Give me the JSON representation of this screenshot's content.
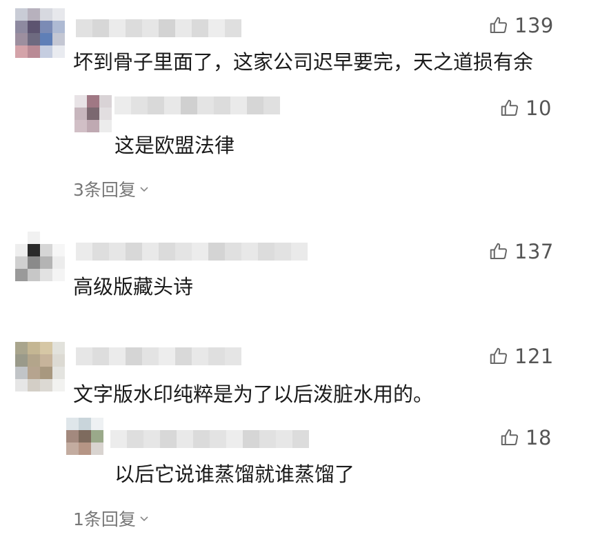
{
  "comments": [
    {
      "likes": "139",
      "text": "坏到骨子里面了，这家公司迟早要完，天之道损有余",
      "replies": [
        {
          "likes": "10",
          "text": "这是欧盟法律"
        }
      ],
      "more_replies": "3条回复"
    },
    {
      "likes": "137",
      "text": "高级版藏头诗",
      "replies": []
    },
    {
      "likes": "121",
      "text": "文字版水印纯粹是为了以后泼脏水用的。",
      "replies": [
        {
          "likes": "18",
          "text": "以后它说谁蒸馏就谁蒸馏了"
        }
      ],
      "more_replies": "1条回复"
    }
  ],
  "icons": {
    "like": "thumbs-up-icon",
    "expand": "chevron-down-icon"
  },
  "colors": {
    "text": "#1a1a1a",
    "muted": "#777777",
    "like": "#555555"
  }
}
